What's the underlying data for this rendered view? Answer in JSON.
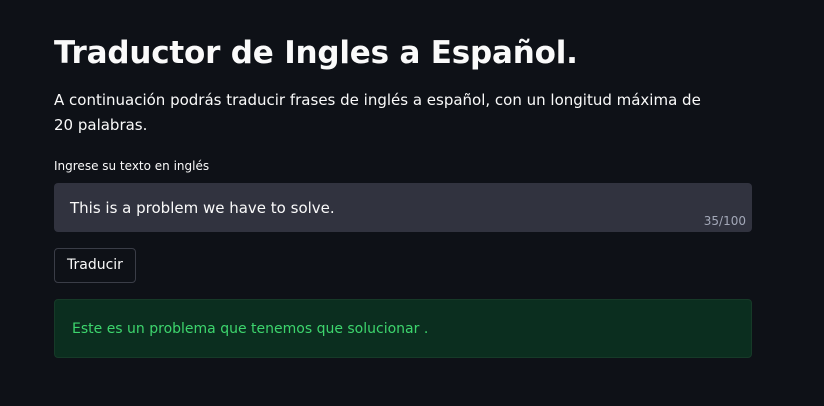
{
  "header": {
    "title": "Traductor de Ingles a Español.",
    "description": "A continuación podrás traducir frases de inglés a español, con un longitud máxima de 20 palabras."
  },
  "input": {
    "label": "Ingrese su texto en inglés",
    "value": "This is a problem we have to solve.",
    "counter": "35/100"
  },
  "actions": {
    "translate_label": "Traducir"
  },
  "result": {
    "text": "Este es un problema que tenemos que solucionar ."
  },
  "colors": {
    "background": "#0e1117",
    "input_background": "#31333f",
    "success_background": "#0b2e1f",
    "success_text": "#3dd56d"
  }
}
